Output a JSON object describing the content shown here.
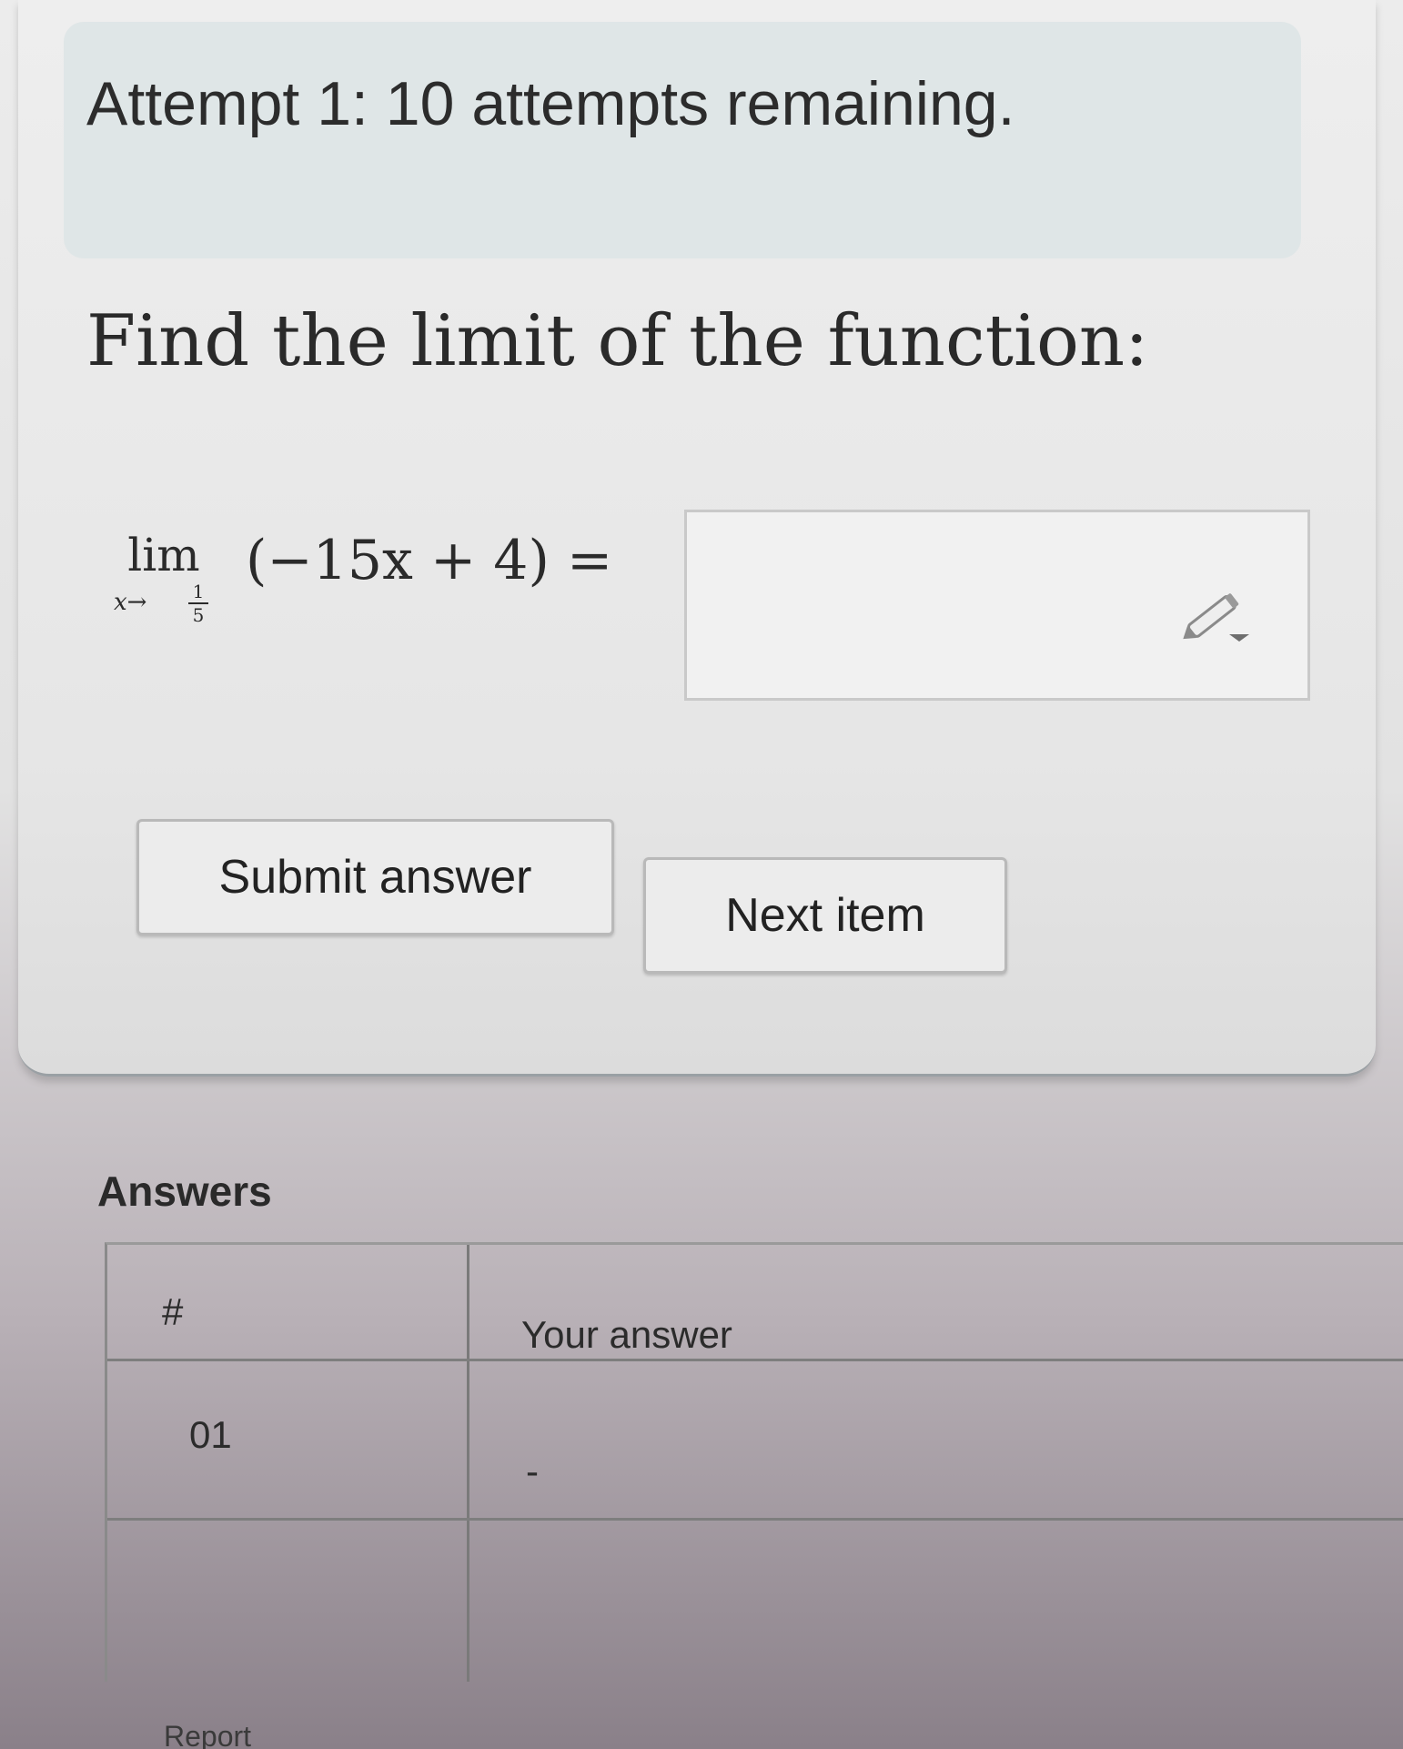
{
  "attempt_banner": {
    "text": "Attempt 1: 10 attempts remaining."
  },
  "question": {
    "title": "Find the limit of the function:",
    "lim_word": "lim",
    "lim_variable": "x→",
    "lim_fraction_numerator": "1",
    "lim_fraction_denominator": "5",
    "expression": "(−15x + 4) =",
    "answer_value": "",
    "pencil_icon": "pencil-icon"
  },
  "buttons": {
    "submit_label": "Submit answer",
    "next_label": "Next item"
  },
  "answers": {
    "heading": "Answers",
    "columns": [
      "#",
      "Your answer"
    ],
    "rows": [
      {
        "number": "01",
        "answer": "-"
      }
    ]
  },
  "footer": {
    "report_text": "Report"
  }
}
